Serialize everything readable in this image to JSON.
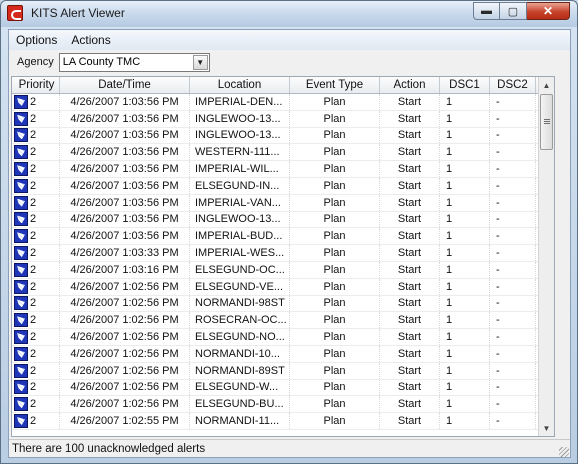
{
  "window": {
    "title": "KITS Alert Viewer"
  },
  "menu": {
    "options": "Options",
    "actions": "Actions"
  },
  "agency": {
    "label": "Agency",
    "value": "LA County TMC"
  },
  "columns": [
    "Priority",
    "Date/Time",
    "Location",
    "Event Type",
    "Action",
    "DSC1",
    "DSC2"
  ],
  "rows": [
    {
      "priority": "2",
      "datetime": "4/26/2007 1:03:56 PM",
      "location": "IMPERIAL-DEN...",
      "event": "Plan",
      "action": "Start",
      "dsc1": "1",
      "dsc2": "-"
    },
    {
      "priority": "2",
      "datetime": "4/26/2007 1:03:56 PM",
      "location": "INGLEWOO-13...",
      "event": "Plan",
      "action": "Start",
      "dsc1": "1",
      "dsc2": "-"
    },
    {
      "priority": "2",
      "datetime": "4/26/2007 1:03:56 PM",
      "location": "INGLEWOO-13...",
      "event": "Plan",
      "action": "Start",
      "dsc1": "1",
      "dsc2": "-"
    },
    {
      "priority": "2",
      "datetime": "4/26/2007 1:03:56 PM",
      "location": "WESTERN-111...",
      "event": "Plan",
      "action": "Start",
      "dsc1": "1",
      "dsc2": "-"
    },
    {
      "priority": "2",
      "datetime": "4/26/2007 1:03:56 PM",
      "location": "IMPERIAL-WIL...",
      "event": "Plan",
      "action": "Start",
      "dsc1": "1",
      "dsc2": "-"
    },
    {
      "priority": "2",
      "datetime": "4/26/2007 1:03:56 PM",
      "location": "ELSEGUND-IN...",
      "event": "Plan",
      "action": "Start",
      "dsc1": "1",
      "dsc2": "-"
    },
    {
      "priority": "2",
      "datetime": "4/26/2007 1:03:56 PM",
      "location": "IMPERIAL-VAN...",
      "event": "Plan",
      "action": "Start",
      "dsc1": "1",
      "dsc2": "-"
    },
    {
      "priority": "2",
      "datetime": "4/26/2007 1:03:56 PM",
      "location": "INGLEWOO-13...",
      "event": "Plan",
      "action": "Start",
      "dsc1": "1",
      "dsc2": "-"
    },
    {
      "priority": "2",
      "datetime": "4/26/2007 1:03:56 PM",
      "location": "IMPERIAL-BUD...",
      "event": "Plan",
      "action": "Start",
      "dsc1": "1",
      "dsc2": "-"
    },
    {
      "priority": "2",
      "datetime": "4/26/2007 1:03:33 PM",
      "location": "IMPERIAL-WES...",
      "event": "Plan",
      "action": "Start",
      "dsc1": "1",
      "dsc2": "-"
    },
    {
      "priority": "2",
      "datetime": "4/26/2007 1:03:16 PM",
      "location": "ELSEGUND-OC...",
      "event": "Plan",
      "action": "Start",
      "dsc1": "1",
      "dsc2": "-"
    },
    {
      "priority": "2",
      "datetime": "4/26/2007 1:02:56 PM",
      "location": "ELSEGUND-VE...",
      "event": "Plan",
      "action": "Start",
      "dsc1": "1",
      "dsc2": "-"
    },
    {
      "priority": "2",
      "datetime": "4/26/2007 1:02:56 PM",
      "location": "NORMANDI-98ST",
      "event": "Plan",
      "action": "Start",
      "dsc1": "1",
      "dsc2": "-"
    },
    {
      "priority": "2",
      "datetime": "4/26/2007 1:02:56 PM",
      "location": "ROSECRAN-OC...",
      "event": "Plan",
      "action": "Start",
      "dsc1": "1",
      "dsc2": "-"
    },
    {
      "priority": "2",
      "datetime": "4/26/2007 1:02:56 PM",
      "location": "ELSEGUND-NO...",
      "event": "Plan",
      "action": "Start",
      "dsc1": "1",
      "dsc2": "-"
    },
    {
      "priority": "2",
      "datetime": "4/26/2007 1:02:56 PM",
      "location": "NORMANDI-10...",
      "event": "Plan",
      "action": "Start",
      "dsc1": "1",
      "dsc2": "-"
    },
    {
      "priority": "2",
      "datetime": "4/26/2007 1:02:56 PM",
      "location": "NORMANDI-89ST",
      "event": "Plan",
      "action": "Start",
      "dsc1": "1",
      "dsc2": "-"
    },
    {
      "priority": "2",
      "datetime": "4/26/2007 1:02:56 PM",
      "location": "ELSEGUND-W...",
      "event": "Plan",
      "action": "Start",
      "dsc1": "1",
      "dsc2": "-"
    },
    {
      "priority": "2",
      "datetime": "4/26/2007 1:02:56 PM",
      "location": "ELSEGUND-BU...",
      "event": "Plan",
      "action": "Start",
      "dsc1": "1",
      "dsc2": "-"
    },
    {
      "priority": "2",
      "datetime": "4/26/2007 1:02:55 PM",
      "location": "NORMANDI-11...",
      "event": "Plan",
      "action": "Start",
      "dsc1": "1",
      "dsc2": "-"
    }
  ],
  "status": {
    "text": "There are 100 unacknowledged alerts"
  },
  "icons": {
    "app": "kits-app-icon",
    "priority": "alert-priority-icon"
  }
}
